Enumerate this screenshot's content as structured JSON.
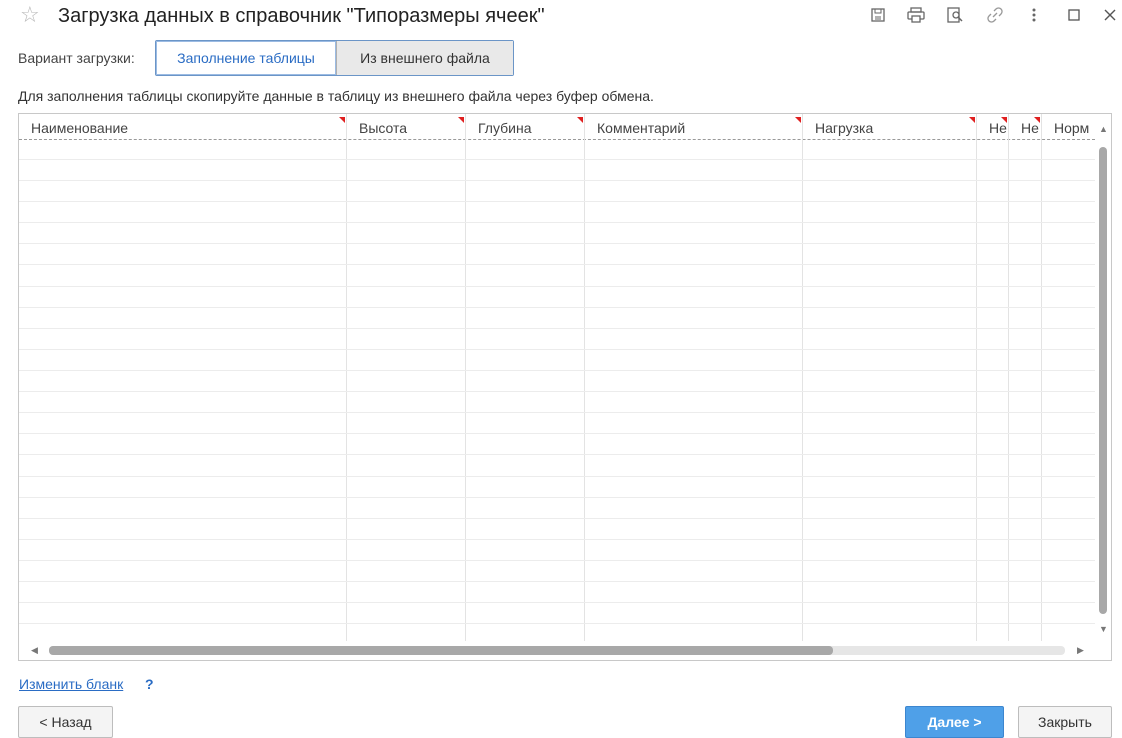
{
  "window": {
    "title": "Загрузка данных в справочник \"Типоразмеры ячеек\"",
    "toolbar_icons": [
      "save-icon",
      "print-icon",
      "preview-icon",
      "link-icon",
      "more-icon",
      "maximize-icon",
      "close-icon"
    ]
  },
  "variant": {
    "label": "Вариант загрузки:",
    "options": [
      "Заполнение таблицы",
      "Из внешнего файла"
    ],
    "selected": "Заполнение таблицы"
  },
  "hint": "Для заполнения таблицы скопируйте данные в таблицу из внешнего файла через буфер обмена.",
  "table": {
    "columns": [
      "Наименование",
      "Высота",
      "Глубина",
      "Комментарий",
      "Нагрузка",
      "Не",
      "Не",
      "Норм"
    ],
    "rows": []
  },
  "footer": {
    "change_form_link": "Изменить бланк",
    "help": "?",
    "back_button": "< Назад",
    "next_button": "Далее >",
    "close_button": "Закрыть"
  },
  "colors": {
    "accent": "#2a6cc4",
    "primary_button": "#4fa0e8",
    "required_mark": "#e02020"
  }
}
